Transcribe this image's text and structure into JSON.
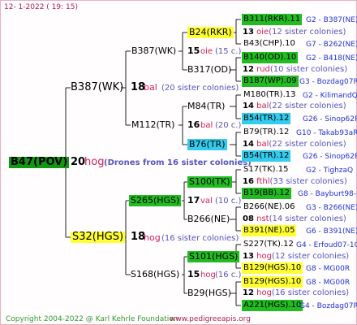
{
  "header": {
    "date": "12-   1-2022 (  19:  15)"
  },
  "root": {
    "label": "B47(POV)",
    "num": "20",
    "breeder": "hog",
    "note": "(Drones from 16 sister colonies)"
  },
  "gen2": {
    "sire": {
      "label": "B387(WK)",
      "num": "18",
      "breeder": "bal",
      "note": "(20 sister colonies)"
    },
    "dam": {
      "label": "S32(HGS)",
      "num": "18",
      "breeder": "hog",
      "note": "(16 sister colonies)"
    }
  },
  "gen3": {
    "a": {
      "label": "B387(WK)",
      "num": "15",
      "breeder": "oie",
      "note": "(15 c.)"
    },
    "b": {
      "label": "M112(TR)",
      "num": "16",
      "breeder": "bal",
      "note": "(20 c.)"
    },
    "c": {
      "label": "S265(HGS)",
      "num": "17",
      "breeder": "val",
      "note": "(10 c.)"
    },
    "d": {
      "label": "S168(HGS)",
      "num": "15",
      "breeder": "hog",
      "note": "(16 c.)"
    }
  },
  "gen4": [
    {
      "label": "B24(RKR)",
      "num": "13",
      "breeder": "oie",
      "note": "(12 sister colonies)"
    },
    {
      "label": "B317(OD)",
      "num": "12",
      "breeder": "rud",
      "note": "(10 sister colonies)"
    },
    {
      "label": "M84(TR)",
      "num": "14",
      "breeder": "bal",
      "note": "(22 sister colonies)"
    },
    {
      "label": "B76(TR)",
      "num": "14",
      "breeder": "bal",
      "note": "(22 sister colonies)"
    },
    {
      "label": "S100(TK)",
      "num": "16",
      "breeder": "fthl",
      "note": "(33 sister colonies)"
    },
    {
      "label": "B266(NE)",
      "num": "08",
      "breeder": "nst",
      "note": "(14 sister colonies)"
    },
    {
      "label": "S101(HGS)",
      "num": "13",
      "breeder": "hog",
      "note": "(12 sister colonies)"
    },
    {
      "label": "B29(HGS)",
      "num": "12",
      "breeder": "hog",
      "note": "(16 sister colonies)"
    }
  ],
  "gen5": [
    {
      "label": "B311(RKR).11",
      "ref": "G2 - B387(NE)"
    },
    {
      "label": "B43(CHP).10",
      "ref": "G7 - B262(NE)"
    },
    {
      "label": "B140(OD).10",
      "ref": "G2 - B418(NE)"
    },
    {
      "label": "B187(WP).09",
      "ref": "G3 - Bozdag07R"
    },
    {
      "label": "M180(TR).13",
      "ref": "G2 - KilimandQ"
    },
    {
      "label": "B54(TR).12",
      "ref": "G26 - Sinop62R"
    },
    {
      "label": "B79(TR).12",
      "ref": "G10 - Takab93aR"
    },
    {
      "label": "B54(TR).12",
      "ref": "G26 - Sinop62R"
    },
    {
      "label": "S17(TK).15",
      "ref": "G2 - TighzaQ"
    },
    {
      "label": "B19(BB).12",
      "ref": "G8 - Bayburt98-3"
    },
    {
      "label": "B266(NE).06",
      "ref": "G3 - B266(NE)"
    },
    {
      "label": "B391(NE).05",
      "ref": "G6 - B391(NE)"
    },
    {
      "label": "S227(TK).12",
      "ref": "G4 - Erfoud07-1Q"
    },
    {
      "label": "B129(HGS).10",
      "ref": "G8 - MG00R"
    },
    {
      "label": "B129(HGS).10",
      "ref": "G8 - MG00R"
    },
    {
      "label": "A221(HGS).10",
      "ref": "G4 - Bozdag07R"
    }
  ],
  "footer": {
    "copyright": "Copyright 2004-2022 @ Karl Kehrle Foundation",
    "site": "www.pedigreeapis.org"
  },
  "colors": {
    "line": "#222222",
    "green": "#22bb22",
    "yellow": "#ffff33",
    "cyan": "#33ccee"
  }
}
